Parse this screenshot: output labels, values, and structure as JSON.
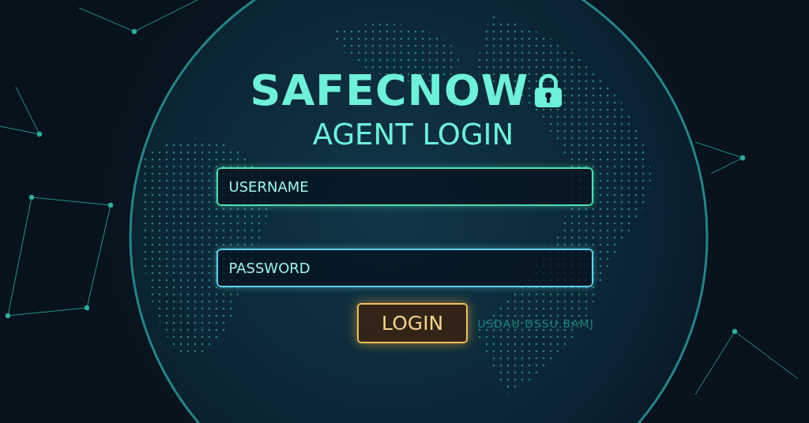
{
  "brand": {
    "name": "SAFECNOW",
    "subtitle": "AGENT LOGIN"
  },
  "fields": [
    {
      "placeholder": "USERNAME",
      "kind": "text"
    },
    {
      "placeholder": "PASSWORD",
      "kind": "password"
    }
  ],
  "login_button": {
    "label": "LOGIN"
  },
  "side_text": "USDAU DSSU.BAMJ"
}
